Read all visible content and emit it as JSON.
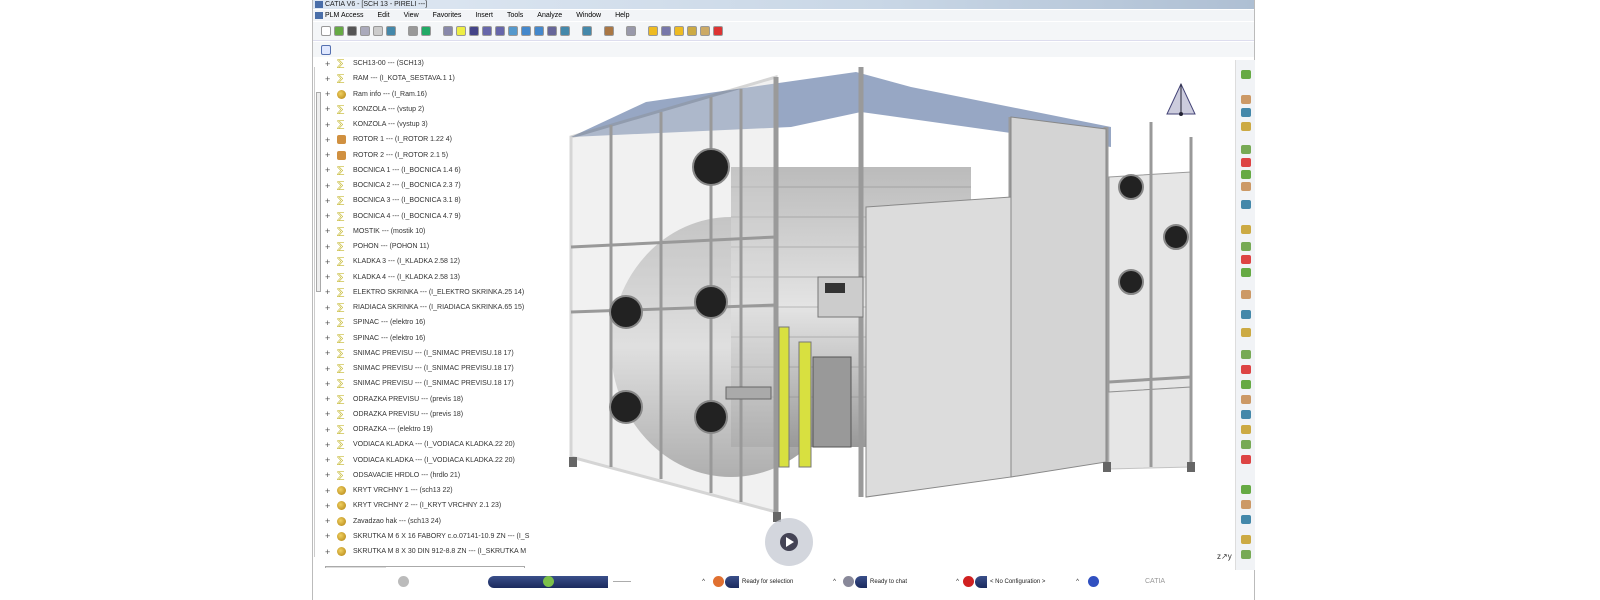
{
  "window": {
    "title": "CATIA V6 - [SCH  13 - PIRELI ---]"
  },
  "menu": [
    "PLM Access",
    "Edit",
    "View",
    "Favorites",
    "Insert",
    "Tools",
    "Analyze",
    "Window",
    "Help"
  ],
  "tree": {
    "items": [
      {
        "label": "SCH13-00 --- (SCH13)",
        "icon": "product"
      },
      {
        "label": "RAM --- (I_KOTA_SESTAVA.1 1)",
        "icon": "product"
      },
      {
        "label": "Ram info --- (I_Ram.16)",
        "icon": "part"
      },
      {
        "label": "KONZOLA --- (vstup 2)",
        "icon": "product"
      },
      {
        "label": "KONZOLA --- (vystup 3)",
        "icon": "product"
      },
      {
        "label": "ROTOR 1 --- (I_ROTOR 1.22 4)",
        "icon": "rotor"
      },
      {
        "label": "ROTOR 2 --- (I_ROTOR 2.1 5)",
        "icon": "rotor"
      },
      {
        "label": "BOCNICA 1 --- (I_BOCNICA 1.4 6)",
        "icon": "product"
      },
      {
        "label": "BOCNICA 2 --- (I_BOCNICA 2.3 7)",
        "icon": "product"
      },
      {
        "label": "BOCNICA 3 --- (I_BOCNICA 3.1 8)",
        "icon": "product"
      },
      {
        "label": "BOCNICA 4 --- (I_BOCNICA 4.7 9)",
        "icon": "product"
      },
      {
        "label": "MOSTIK --- (mostik 10)",
        "icon": "product"
      },
      {
        "label": "POHON --- (POHON 11)",
        "icon": "product"
      },
      {
        "label": "KLADKA 3 --- (I_KLADKA 2.58 12)",
        "icon": "product"
      },
      {
        "label": "KLADKA 4 --- (I_KLADKA 2.58 13)",
        "icon": "product"
      },
      {
        "label": "ELEKTRO SKRINKA --- (I_ELEKTRO SKRINKA.25 14)",
        "icon": "product"
      },
      {
        "label": "RIADIACA SKRINKA --- (I_RIADIACA SKRINKA.65 15)",
        "icon": "product"
      },
      {
        "label": "SPINAC --- (elektro 16)",
        "icon": "product"
      },
      {
        "label": "SPINAC --- (elektro 16)",
        "icon": "product"
      },
      {
        "label": "SNIMAC PREVISU --- (I_SNIMAC PREVISU.18 17)",
        "icon": "product"
      },
      {
        "label": "SNIMAC PREVISU --- (I_SNIMAC PREVISU.18 17)",
        "icon": "product"
      },
      {
        "label": "SNIMAC PREVISU --- (I_SNIMAC PREVISU.18 17)",
        "icon": "product"
      },
      {
        "label": "ODRAZKA PREVISU --- (previs 18)",
        "icon": "product"
      },
      {
        "label": "ODRAZKA PREVISU --- (previs 18)",
        "icon": "product"
      },
      {
        "label": "ODRAZKA --- (elektro 19)",
        "icon": "product"
      },
      {
        "label": "VODIACA KLADKA --- (I_VODIACA KLADKA.22 20)",
        "icon": "product"
      },
      {
        "label": "VODIACA KLADKA --- (I_VODIACA KLADKA.22 20)",
        "icon": "product"
      },
      {
        "label": "ODSAVACIE HRDLO --- (hrdlo 21)",
        "icon": "product"
      },
      {
        "label": "KRYT VRCHNY 1 --- (sch13 22)",
        "icon": "part"
      },
      {
        "label": "KRYT VRCHNY 2 --- (I_KRYT VRCHNY 2.1 23)",
        "icon": "part"
      },
      {
        "label": "Zavadzao hak --- (sch13 24)",
        "icon": "part"
      },
      {
        "label": "SKRUTKA M 6 X 16 FABORY c.o.07141-10.9 ZN --- (I_S",
        "icon": "part"
      },
      {
        "label": "SKRUTKA M 8 X 30 DIN 912-8.8 ZN --- (I_SKRUTKA M",
        "icon": "part"
      }
    ]
  },
  "status": {
    "field1": "---------",
    "field2": "Ready for selection",
    "field3": "Ready to chat",
    "field4": "< No Configuration >",
    "brand": "CATIA"
  },
  "colors": {
    "status_bar": "#1b2a5e",
    "model_frame": "#9a9a9a",
    "accent_yellow": "#d8e040"
  }
}
